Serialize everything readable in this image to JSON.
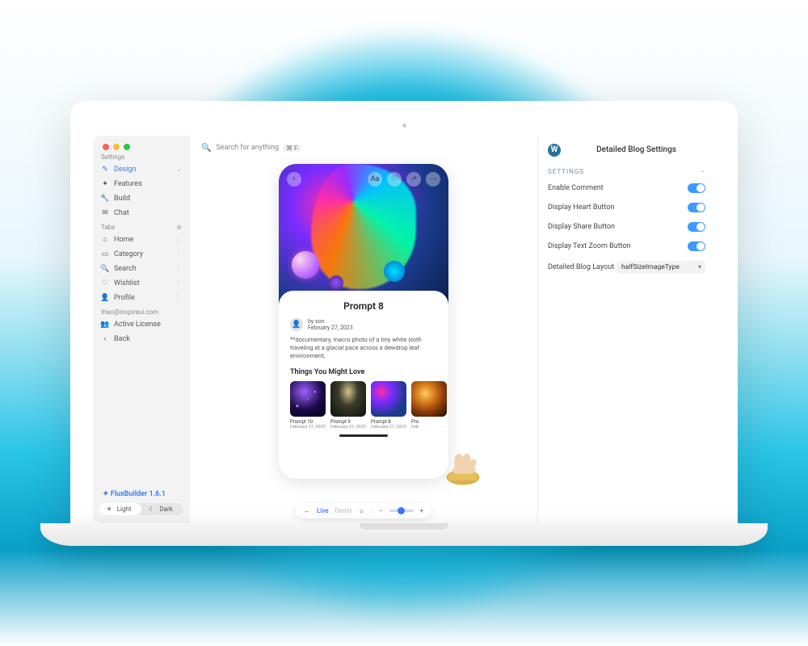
{
  "search": {
    "placeholder": "Search for anything",
    "shortcut": "⌘ F"
  },
  "sidebar": {
    "section_settings": "Settings",
    "settings": [
      {
        "label": "Design",
        "icon": "✎",
        "active": true
      },
      {
        "label": "Features",
        "icon": "✦"
      },
      {
        "label": "Build",
        "icon": "🔧"
      },
      {
        "label": "Chat",
        "icon": "✉"
      }
    ],
    "section_tabs": "Tabs",
    "tabs": [
      {
        "label": "Home",
        "icon": "⌂"
      },
      {
        "label": "Category",
        "icon": "▭"
      },
      {
        "label": "Search",
        "icon": "🔍"
      },
      {
        "label": "Wishlist",
        "icon": "♡"
      },
      {
        "label": "Profile",
        "icon": "👤"
      }
    ],
    "account_email": "thao@inspireui.com",
    "account": [
      {
        "label": "Active License",
        "icon": "👥"
      },
      {
        "label": "Back",
        "icon": "‹"
      }
    ],
    "brand": "FluxBuilder 1.6.1",
    "theme": {
      "light": "Light",
      "dark": "Dark"
    }
  },
  "phone": {
    "title": "Prompt 8",
    "author_prefix": "by",
    "author": "son",
    "date": "February 27, 2023",
    "description": "**documentary, macro photo of a tiny white sloth traveling at a glacial pace across a dewdrop leaf environment,",
    "related_heading": "Things You Might Love",
    "related": [
      {
        "title": "Prompt 10",
        "date": "February 27, 2023"
      },
      {
        "title": "Prompt 9",
        "date": "February 27, 2023"
      },
      {
        "title": "Prompt 8",
        "date": "February 27, 2023"
      },
      {
        "title": "Pro",
        "date": "Feb"
      }
    ]
  },
  "dock": {
    "live": "Live",
    "demo": "Demo"
  },
  "panel": {
    "title": "Detailed Blog Settings",
    "group": "SETTINGS",
    "rows": [
      {
        "label": "Enable Comment"
      },
      {
        "label": "Display Heart Button"
      },
      {
        "label": "Display Share Button"
      },
      {
        "label": "Display Text Zoom Button"
      }
    ],
    "layout_label": "Detailed Blog Layout",
    "layout_value": "halfSizeImageType"
  }
}
